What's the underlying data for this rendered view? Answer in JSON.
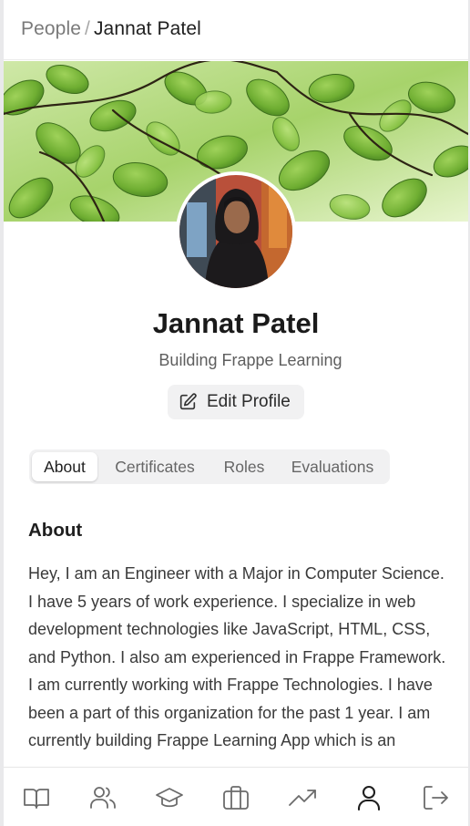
{
  "breadcrumb": {
    "parent": "People",
    "separator": "/",
    "current": "Jannat Patel"
  },
  "profile": {
    "name": "Jannat Patel",
    "bio": "Building Frappe Learning",
    "edit_label": "Edit Profile",
    "edit_icon": "edit-icon"
  },
  "tabs": [
    {
      "label": "About",
      "active": true
    },
    {
      "label": "Certificates",
      "active": false
    },
    {
      "label": "Roles",
      "active": false
    },
    {
      "label": "Evaluations",
      "active": false
    }
  ],
  "about": {
    "heading": "About",
    "text": "Hey, I am an Engineer with a Major in Computer Science. I have 5 years of work experience. I specialize in web development technologies like JavaScript, HTML, CSS, and Python. I also am experienced in Frappe Framework. I am currently working with Frappe Technologies. I have been a part of this organization for the past 1 year. I am currently building Frappe Learning App which is an"
  },
  "bottom_nav": [
    {
      "icon": "book-icon",
      "active": false
    },
    {
      "icon": "people-icon",
      "active": false
    },
    {
      "icon": "graduation-cap-icon",
      "active": false
    },
    {
      "icon": "briefcase-icon",
      "active": false
    },
    {
      "icon": "trending-up-icon",
      "active": false
    },
    {
      "icon": "user-icon",
      "active": true
    },
    {
      "icon": "logout-icon",
      "active": false
    }
  ],
  "colors": {
    "text_primary": "#1f1f1f",
    "text_muted": "#666666",
    "surface_gray": "#f1f1f2",
    "leaf_green": "#5f9e2e"
  }
}
